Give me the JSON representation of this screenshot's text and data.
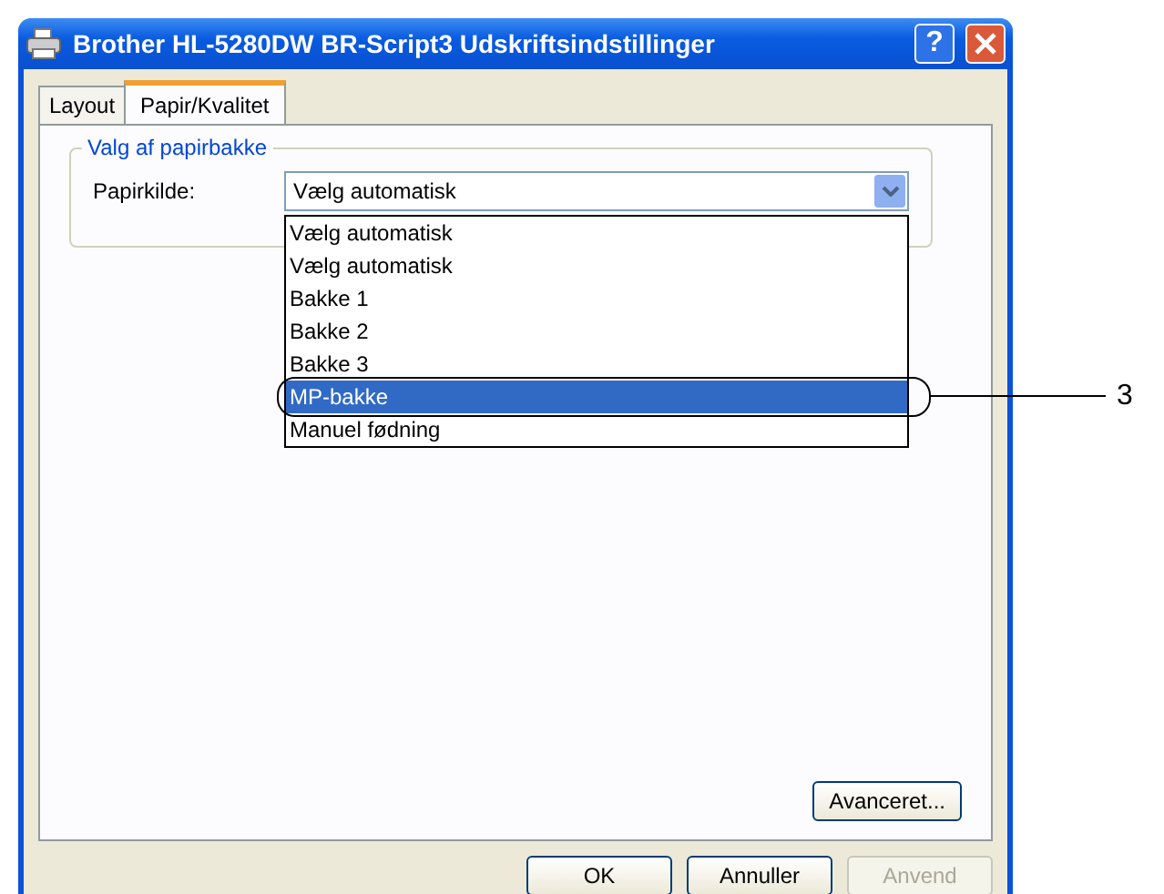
{
  "window": {
    "title": "Brother HL-5280DW BR-Script3 Udskriftsindstillinger",
    "help_button": "?"
  },
  "tabs": [
    {
      "label": "Layout",
      "selected": false
    },
    {
      "label": "Papir/Kvalitet",
      "selected": true
    }
  ],
  "group": {
    "title": "Valg af papirbakke",
    "field_label": "Papirkilde:",
    "dropdown": {
      "value": "Vælg automatisk",
      "expanded": true
    },
    "options": [
      {
        "label": "Vælg automatisk",
        "selected": false
      },
      {
        "label": "Vælg automatisk",
        "selected": false
      },
      {
        "label": "Bakke 1",
        "selected": false
      },
      {
        "label": "Bakke 2",
        "selected": false
      },
      {
        "label": "Bakke 3",
        "selected": false
      },
      {
        "label": "MP-bakke",
        "selected": true
      },
      {
        "label": "Manuel fødning",
        "selected": false
      }
    ]
  },
  "callout": {
    "label": "3"
  },
  "advanced_button": {
    "label": "Avanceret...",
    "disabled": false
  },
  "buttons": [
    {
      "label": "OK",
      "disabled": false
    },
    {
      "label": "Annuller",
      "disabled": false
    },
    {
      "label": "Anvend",
      "disabled": true
    }
  ]
}
